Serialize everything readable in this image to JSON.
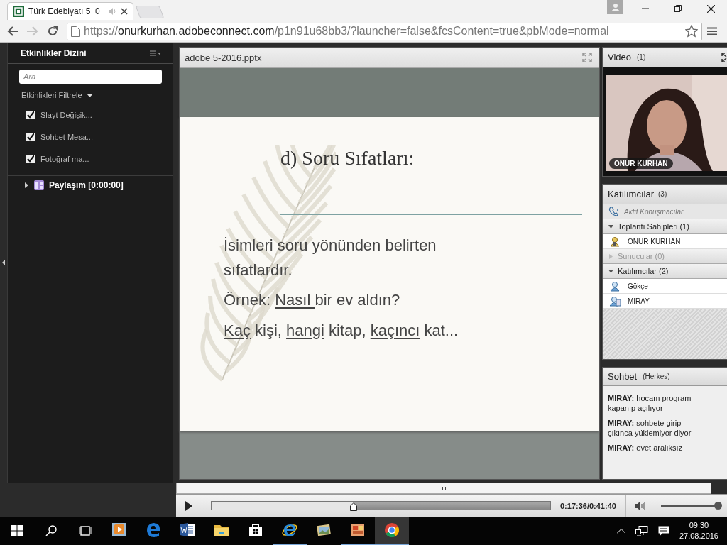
{
  "browser": {
    "tab": {
      "title": "Türk Edebiyatı 5_0"
    },
    "address": {
      "scheme": "https://",
      "host": "onurkurhan.adobeconnect.com",
      "path": "/p1n91u68bb3/?launcher=false&fcsContent=true&pbMode=normal"
    }
  },
  "events_pod": {
    "title": "Etkinlikler Dizini",
    "search": {
      "placeholder": "Ara"
    },
    "filter_label": "Etkinlikleri Filtrele",
    "filters": [
      {
        "label": "Slayt Değişik...",
        "checked": true
      },
      {
        "label": "Sohbet Mesa...",
        "checked": true
      },
      {
        "label": "Fotoğraf ma...",
        "checked": true
      }
    ],
    "items": [
      {
        "label": "Paylaşım [0:00:00]",
        "expanded": false
      }
    ]
  },
  "share_pod": {
    "title": "adobe 5-2016.pptx",
    "slide": {
      "title": "d) Soru Sıfatları:",
      "lines": [
        [
          {
            "text": "İsimleri soru yönünden belirten",
            "underline": false
          }
        ],
        [
          {
            "text": "sıfatlardır.",
            "underline": false
          }
        ],
        [
          {
            "text": "Örnek: ",
            "underline": false
          },
          {
            "text": "Nasıl ",
            "underline": true
          },
          {
            "text": "bir ev aldın?",
            "underline": false
          }
        ],
        [
          {
            "text": "Kaç",
            "underline": true
          },
          {
            "text": " kişi, ",
            "underline": false
          },
          {
            "text": "hangi",
            "underline": true
          },
          {
            "text": " kitap, ",
            "underline": false
          },
          {
            "text": "kaçıncı",
            "underline": true
          },
          {
            "text": " kat...",
            "underline": false
          }
        ]
      ]
    }
  },
  "video_pod": {
    "title": "Video",
    "count": "(1)",
    "caption": "ONUR KURHAN"
  },
  "attendees_pod": {
    "title": "Katılımcılar",
    "count": "(3)",
    "active_speakers": "Aktif Konuşmacılar",
    "groups": [
      {
        "label": "Toplantı Sahipleri (1)",
        "expanded": true,
        "members": [
          {
            "name": "ONUR KURHAN",
            "kind": "host"
          }
        ]
      },
      {
        "label": "Sunucular (0)",
        "expanded": false
      },
      {
        "label": "Katılımcılar (2)",
        "expanded": true,
        "members": [
          {
            "name": "Gökçe",
            "kind": "participant"
          },
          {
            "name": "MIRAY",
            "kind": "mobile"
          }
        ]
      }
    ]
  },
  "chat_pod": {
    "title": "Sohbet",
    "scope": "(Herkes)",
    "messages": [
      "**MIRAY:** hocam program kapanıp açılıyor",
      "**MIRAY:** sohbete girip çıkınca yüklemiyor diyor",
      "**MIRAY:** evet aralıksız"
    ]
  },
  "playback": {
    "level": 0.42,
    "time": "0:17:36/0:41:40",
    "volume": {
      "level": 0.95
    }
  },
  "taskbar": {
    "apps": [
      {
        "kind": "media",
        "selected": false,
        "running": false
      },
      {
        "kind": "edge",
        "selected": false,
        "running": false
      },
      {
        "kind": "word",
        "selected": false,
        "running": false
      },
      {
        "kind": "explorer",
        "selected": false,
        "running": false
      },
      {
        "kind": "store",
        "selected": false,
        "running": false
      },
      {
        "kind": "ie",
        "selected": false,
        "running": true
      },
      {
        "kind": "mail",
        "selected": false,
        "running": false
      },
      {
        "kind": "office",
        "selected": false,
        "running": true
      },
      {
        "kind": "chrome",
        "selected": true,
        "running": true
      }
    ],
    "time": "09:30",
    "date": "27.08.2016"
  }
}
